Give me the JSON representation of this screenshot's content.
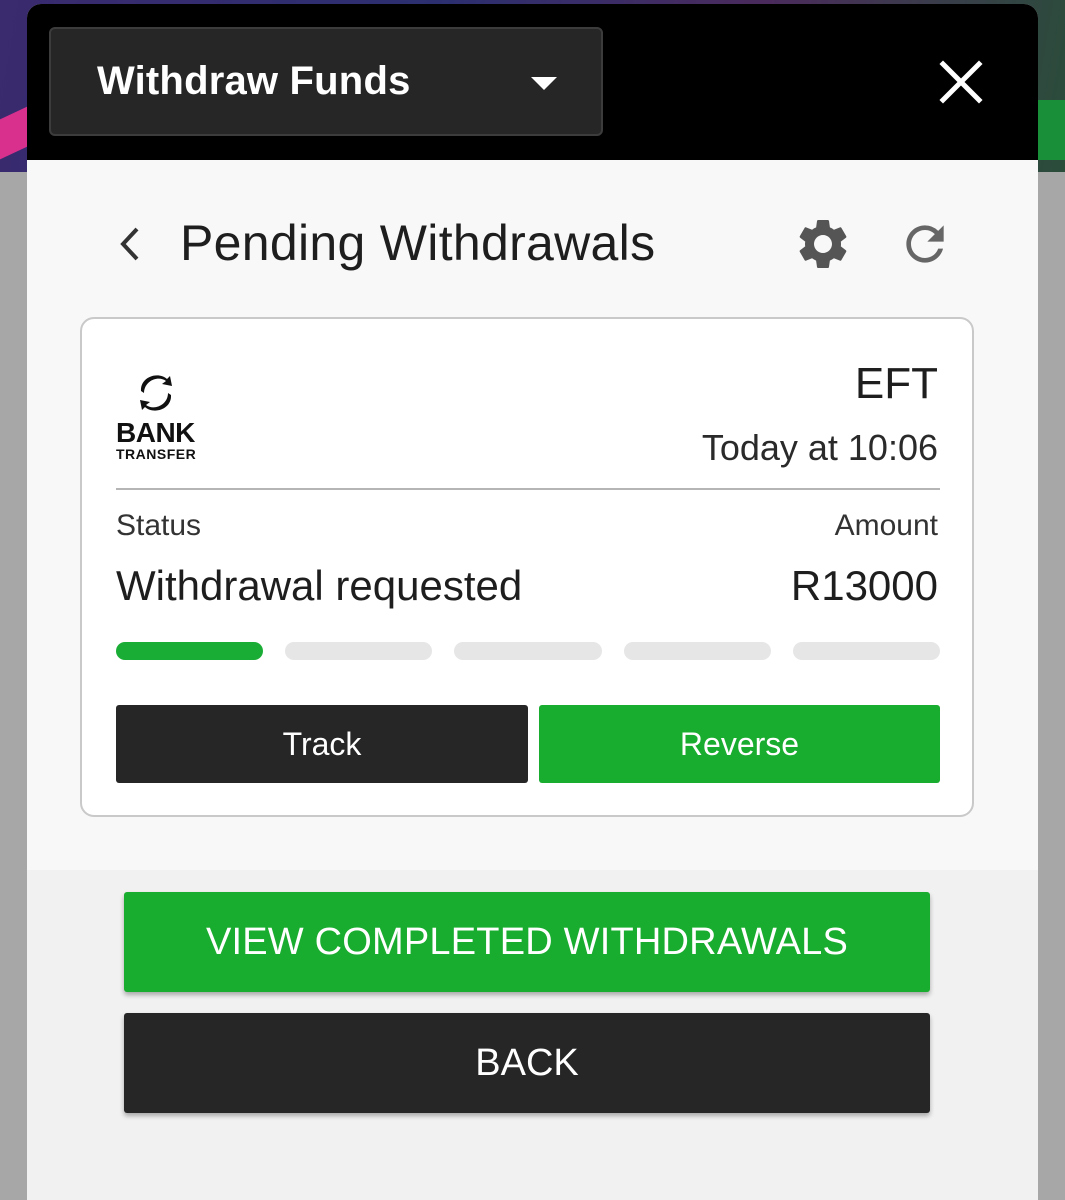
{
  "header": {
    "dropdown_label": "Withdraw Funds"
  },
  "page": {
    "title": "Pending Withdrawals"
  },
  "withdrawal": {
    "logo_text_top": "BANK",
    "logo_text_bottom": "TRANSFER",
    "method": "EFT",
    "time": "Today at 10:06",
    "status_label": "Status",
    "amount_label": "Amount",
    "status_value": "Withdrawal requested",
    "amount_value": "R13000",
    "progress": {
      "completed_steps": 1,
      "total_steps": 5
    },
    "track_label": "Track",
    "reverse_label": "Reverse"
  },
  "actions": {
    "view_completed_label": "VIEW COMPLETED WITHDRAWALS",
    "back_label": "BACK"
  },
  "colors": {
    "accent_green": "#19ad2f",
    "dark_button": "#262626"
  }
}
